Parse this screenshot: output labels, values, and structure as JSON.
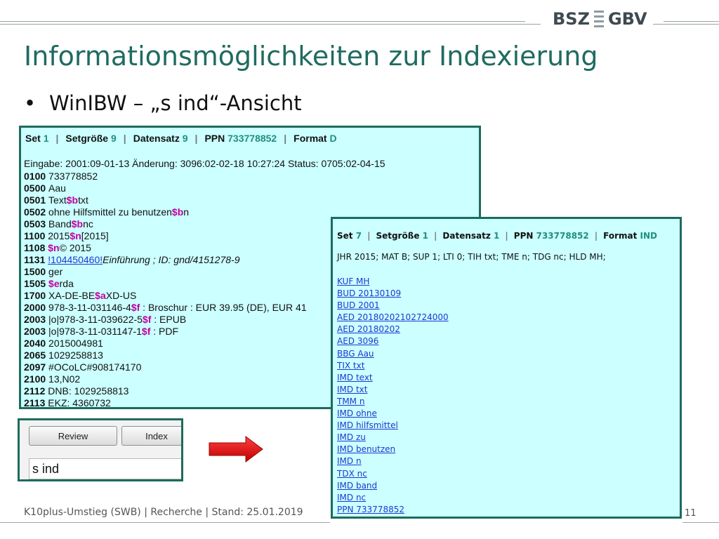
{
  "logo": {
    "left": "BSZ",
    "right": "GBV"
  },
  "title": "Informationsmöglichkeiten zur Indexierung",
  "bullet": "WinIBW – „s ind“-Ansicht",
  "panel1": {
    "header": [
      {
        "label": "Set",
        "value": "1"
      },
      {
        "label": "Setgröße",
        "value": "9"
      },
      {
        "label": "Datensatz",
        "value": "9"
      },
      {
        "label": "PPN",
        "value": "733778852"
      },
      {
        "label": "Format",
        "value": "D"
      }
    ],
    "entry_line": "Eingabe: 2001:09-01-13 Änderung: 3096:02-02-18 10:27:24 Status: 0705:02-04-15",
    "rows": [
      {
        "tag": "0100",
        "parts": [
          {
            "t": "733778852"
          }
        ]
      },
      {
        "tag": "0500",
        "parts": [
          {
            "t": "Aau"
          }
        ]
      },
      {
        "tag": "0501",
        "parts": [
          {
            "t": "Text"
          },
          {
            "t": "$b",
            "s": "sf"
          },
          {
            "t": "txt"
          }
        ]
      },
      {
        "tag": "0502",
        "parts": [
          {
            "t": "ohne Hilfsmittel zu benutzen"
          },
          {
            "t": "$b",
            "s": "sf"
          },
          {
            "t": "n"
          }
        ]
      },
      {
        "tag": "0503",
        "parts": [
          {
            "t": "Band"
          },
          {
            "t": "$b",
            "s": "sf"
          },
          {
            "t": "nc"
          }
        ]
      },
      {
        "tag": "1100",
        "parts": [
          {
            "t": "2015"
          },
          {
            "t": "$n",
            "s": "sf"
          },
          {
            "t": "[2015]"
          }
        ]
      },
      {
        "tag": "1108",
        "parts": [
          {
            "t": "$n",
            "s": "sf"
          },
          {
            "t": "© 2015"
          }
        ]
      },
      {
        "tag": "1131",
        "parts": [
          {
            "t": "!104450460!",
            "s": "lnk"
          },
          {
            "t": "Einführung ; ID: gnd/4151278-9",
            "s": "it"
          }
        ]
      },
      {
        "tag": "1500",
        "parts": [
          {
            "t": "ger"
          }
        ]
      },
      {
        "tag": "1505",
        "parts": [
          {
            "t": "$e",
            "s": "sf"
          },
          {
            "t": "rda"
          }
        ]
      },
      {
        "tag": "1700",
        "parts": [
          {
            "t": "XA-DE-BE"
          },
          {
            "t": "$a",
            "s": "sf"
          },
          {
            "t": "XD-US"
          }
        ]
      },
      {
        "tag": "2000",
        "parts": [
          {
            "t": "978-3-11-031146-4"
          },
          {
            "t": "$f",
            "s": "sf"
          },
          {
            "t": " : Broschur : EUR 39.95 (DE), EUR 41"
          }
        ]
      },
      {
        "tag": "2003",
        "parts": [
          {
            "t": "|o|978-3-11-039622-5"
          },
          {
            "t": "$f",
            "s": "sf"
          },
          {
            "t": " : EPUB"
          }
        ]
      },
      {
        "tag": "2003",
        "parts": [
          {
            "t": "|o|978-3-11-031147-1"
          },
          {
            "t": "$f",
            "s": "sf"
          },
          {
            "t": " : PDF"
          }
        ]
      },
      {
        "tag": "2040",
        "parts": [
          {
            "t": "2015004981"
          }
        ]
      },
      {
        "tag": "2065",
        "parts": [
          {
            "t": "1029258813"
          }
        ]
      },
      {
        "tag": "2097",
        "parts": [
          {
            "t": "#OCoLC#908174170"
          }
        ]
      },
      {
        "tag": "2100",
        "parts": [
          {
            "t": "13,N02"
          }
        ]
      },
      {
        "tag": "2112",
        "parts": [
          {
            "t": "DNB: 1029258813"
          }
        ]
      },
      {
        "tag": "2113",
        "parts": [
          {
            "t": "EKZ: 4360732"
          }
        ]
      }
    ]
  },
  "panel2": {
    "header": [
      {
        "label": "Set",
        "value": "7"
      },
      {
        "label": "Setgröße",
        "value": "1"
      },
      {
        "label": "Datensatz",
        "value": "1"
      },
      {
        "label": "PPN",
        "value": "733778852"
      },
      {
        "label": "Format",
        "value": "IND"
      }
    ],
    "summary_line": "JHR 2015; MAT B; SUP 1; LTI 0; TIH txt; TME n; TDG nc; HLD MH;",
    "items": [
      "KUF MH",
      "BUD 20130109",
      "BUD 2001",
      "AED 20180202102724000",
      "AED 20180202",
      "AED 3096",
      "BBG Aau",
      "TIX txt",
      "IMD text",
      "IMD txt",
      "TMM n",
      "IMD ohne",
      "IMD hilfsmittel",
      "IMD zu",
      "IMD benutzen",
      "IMD n",
      "TDX nc",
      "IMD band",
      "IMD nc",
      "PPN 733778852"
    ]
  },
  "command": {
    "review_label": "Review",
    "index_label": "Index",
    "input_value": "s ind"
  },
  "footer": {
    "text": "K10plus-Umstieg (SWB) | Recherche | Stand: 25.01.2019",
    "page": "11"
  },
  "colors": {
    "accent": "#1f6b61",
    "panel_bg": "#ccffff",
    "subfield": "#c000a0",
    "link": "#1a3ad0",
    "arrow": "#e00000"
  }
}
